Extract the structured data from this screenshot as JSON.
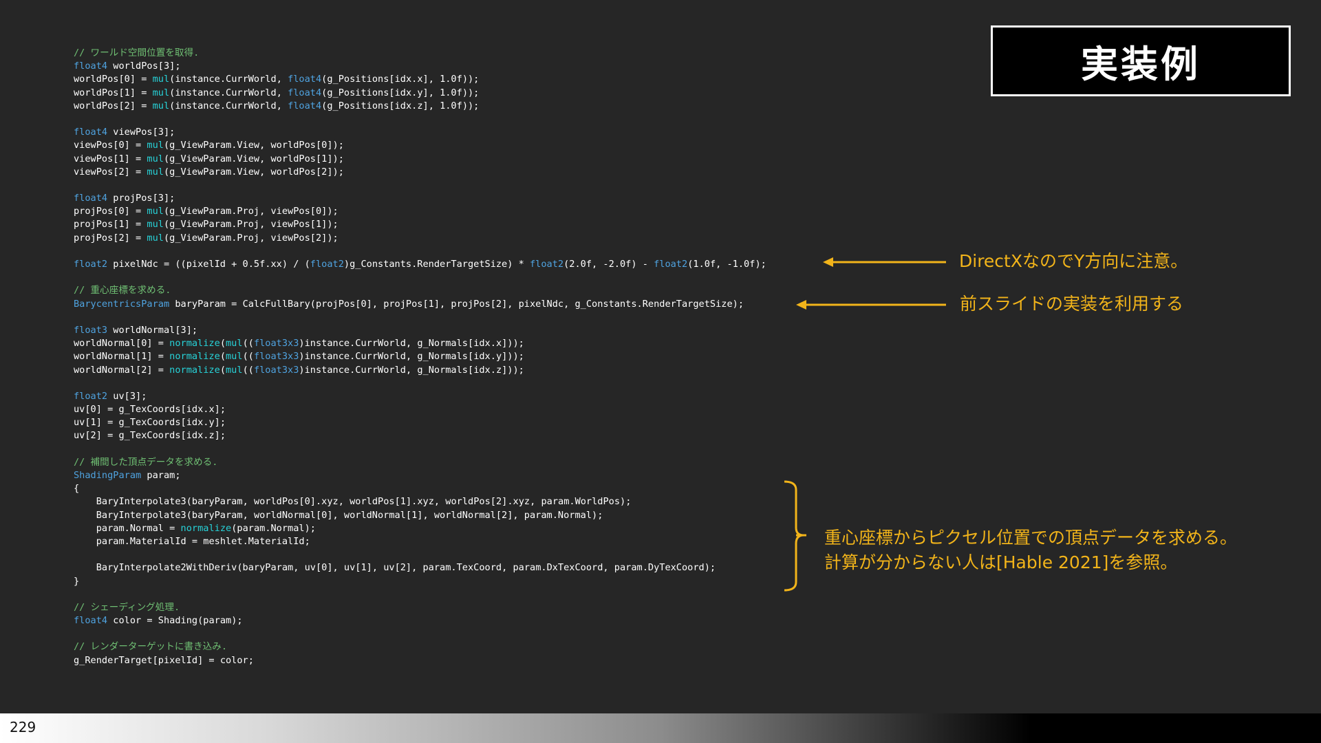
{
  "title": "実装例",
  "page_number": "229",
  "notes": {
    "directx": "DirectXなのでY方向に注意。",
    "prev_slide": "前スライドの実装を利用する",
    "bary_line1": "重心座標からピクセル位置での頂点データを求める。",
    "bary_line2": "計算が分からない人は[Hable 2021]を参照。"
  },
  "code": [
    {
      "t": "// ワールド空間位置を取得.",
      "k": "cm"
    },
    {
      "t": "float4 worldPos[3];"
    },
    {
      "t": "worldPos[0] = mul(instance.CurrWorld, float4(g_Positions[idx.x], 1.0f));"
    },
    {
      "t": "worldPos[1] = mul(instance.CurrWorld, float4(g_Positions[idx.y], 1.0f));"
    },
    {
      "t": "worldPos[2] = mul(instance.CurrWorld, float4(g_Positions[idx.z], 1.0f));"
    },
    {
      "t": ""
    },
    {
      "t": "float4 viewPos[3];"
    },
    {
      "t": "viewPos[0] = mul(g_ViewParam.View, worldPos[0]);"
    },
    {
      "t": "viewPos[1] = mul(g_ViewParam.View, worldPos[1]);"
    },
    {
      "t": "viewPos[2] = mul(g_ViewParam.View, worldPos[2]);"
    },
    {
      "t": ""
    },
    {
      "t": "float4 projPos[3];"
    },
    {
      "t": "projPos[0] = mul(g_ViewParam.Proj, viewPos[0]);"
    },
    {
      "t": "projPos[1] = mul(g_ViewParam.Proj, viewPos[1]);"
    },
    {
      "t": "projPos[2] = mul(g_ViewParam.Proj, viewPos[2]);"
    },
    {
      "t": ""
    },
    {
      "t": "float2 pixelNdc = ((pixelId + 0.5f.xx) / (float2)g_Constants.RenderTargetSize) * float2(2.0f, -2.0f) - float2(1.0f, -1.0f);"
    },
    {
      "t": ""
    },
    {
      "t": "// 重心座標を求める.",
      "k": "cm"
    },
    {
      "t": "BarycentricsParam baryParam = CalcFullBary(projPos[0], projPos[1], projPos[2], pixelNdc, g_Constants.RenderTargetSize);"
    },
    {
      "t": ""
    },
    {
      "t": "float3 worldNormal[3];"
    },
    {
      "t": "worldNormal[0] = normalize(mul((float3x3)instance.CurrWorld, g_Normals[idx.x]));"
    },
    {
      "t": "worldNormal[1] = normalize(mul((float3x3)instance.CurrWorld, g_Normals[idx.y]));"
    },
    {
      "t": "worldNormal[2] = normalize(mul((float3x3)instance.CurrWorld, g_Normals[idx.z]));"
    },
    {
      "t": ""
    },
    {
      "t": "float2 uv[3];"
    },
    {
      "t": "uv[0] = g_TexCoords[idx.x];"
    },
    {
      "t": "uv[1] = g_TexCoords[idx.y];"
    },
    {
      "t": "uv[2] = g_TexCoords[idx.z];"
    },
    {
      "t": ""
    },
    {
      "t": "// 補間した頂点データを求める.",
      "k": "cm"
    },
    {
      "t": "ShadingParam param;"
    },
    {
      "t": "{"
    },
    {
      "t": "    BaryInterpolate3(baryParam, worldPos[0].xyz, worldPos[1].xyz, worldPos[2].xyz, param.WorldPos);"
    },
    {
      "t": "    BaryInterpolate3(baryParam, worldNormal[0], worldNormal[1], worldNormal[2], param.Normal);"
    },
    {
      "t": "    param.Normal = normalize(param.Normal);"
    },
    {
      "t": "    param.MaterialId = meshlet.MaterialId;"
    },
    {
      "t": ""
    },
    {
      "t": "    BaryInterpolate2WithDeriv(baryParam, uv[0], uv[1], uv[2], param.TexCoord, param.DxTexCoord, param.DyTexCoord);"
    },
    {
      "t": "}"
    },
    {
      "t": ""
    },
    {
      "t": "// シェーディング処理.",
      "k": "cm"
    },
    {
      "t": "float4 color = Shading(param);"
    },
    {
      "t": ""
    },
    {
      "t": "// レンダーターゲットに書き込み.",
      "k": "cm"
    },
    {
      "t": "g_RenderTarget[pixelId] = color;"
    }
  ],
  "colors": {
    "background": "#262626",
    "annotation": "#f2b41a",
    "comment": "#6fbf73",
    "type": "#4fa3e0",
    "function": "#27d3d9"
  }
}
